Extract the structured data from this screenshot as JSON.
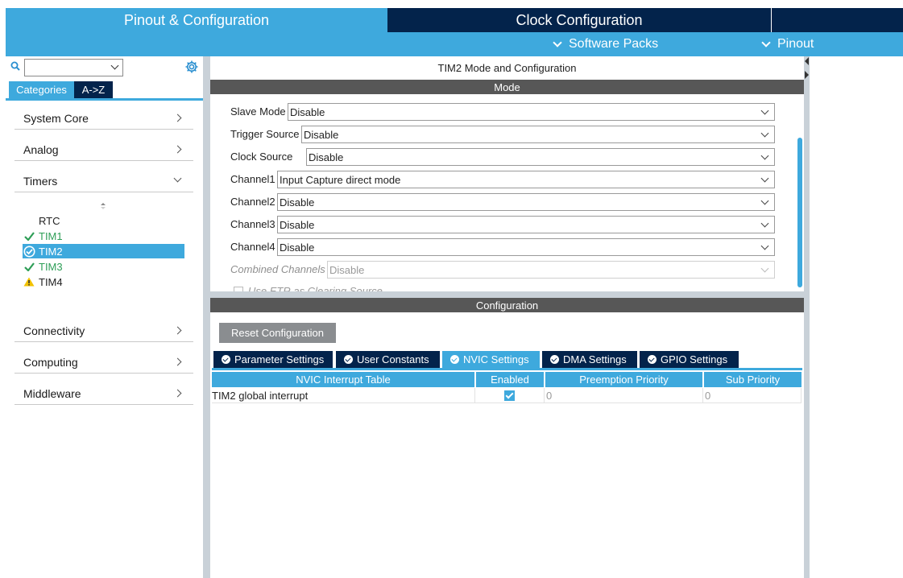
{
  "top_tabs": {
    "pinout": "Pinout & Configuration",
    "clock": "Clock Configuration"
  },
  "subbar": {
    "software_packs": "Software Packs",
    "pinout": "Pinout"
  },
  "left": {
    "search_value": "",
    "tabs": [
      "Categories",
      "A->Z"
    ],
    "categories": [
      "System Core",
      "Analog",
      "Timers",
      "Connectivity",
      "Computing",
      "Middleware"
    ],
    "timers": [
      {
        "label": "RTC",
        "status": "none"
      },
      {
        "label": "TIM1",
        "status": "ok"
      },
      {
        "label": "TIM2",
        "status": "ok-selected"
      },
      {
        "label": "TIM3",
        "status": "ok"
      },
      {
        "label": "TIM4",
        "status": "warning"
      }
    ]
  },
  "main": {
    "title": "TIM2 Mode and Configuration",
    "mode_header": "Mode",
    "config_header": "Configuration",
    "mode_rows": [
      {
        "label": "Slave Mode",
        "value": "Disable"
      },
      {
        "label": "Trigger Source",
        "value": "Disable"
      },
      {
        "label": "Clock Source",
        "value": "Disable"
      },
      {
        "label": "Channel1",
        "value": "Input Capture direct mode"
      },
      {
        "label": "Channel2",
        "value": "Disable"
      },
      {
        "label": "Channel3",
        "value": "Disable"
      },
      {
        "label": "Channel4",
        "value": "Disable"
      },
      {
        "label": "Combined Channels",
        "value": "Disable"
      }
    ],
    "cut_row": "Use ETR as Clearing Source",
    "reset_button": "Reset Configuration",
    "config_tabs": [
      "Parameter Settings",
      "User Constants",
      "NVIC Settings",
      "DMA Settings",
      "GPIO Settings"
    ],
    "active_config_tab": "NVIC Settings",
    "table": {
      "headers": [
        "NVIC Interrupt Table",
        "Enabled",
        "Preemption Priority",
        "Sub Priority"
      ],
      "rows": [
        {
          "name": "TIM2 global interrupt",
          "enabled": true,
          "preemption": "0",
          "sub": "0"
        }
      ]
    }
  },
  "colors": {
    "accent": "#3ea9dd",
    "dark": "#03234b",
    "ok": "#2e9e57",
    "warning": "#f2c200"
  }
}
